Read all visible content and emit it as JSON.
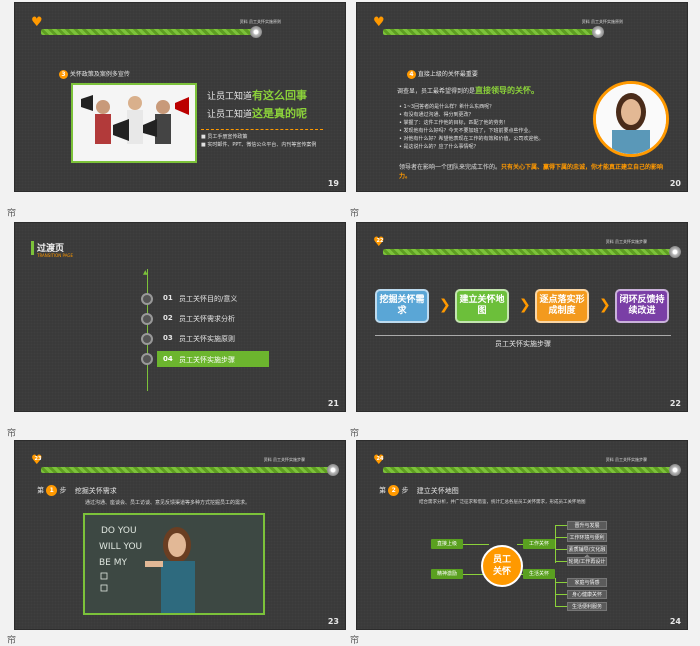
{
  "slides": {
    "s19": {
      "page": "19",
      "header_caption": "资料 员工关怀实施原则",
      "heading_num": "3",
      "heading": "关怀政策及案例多宣传",
      "line1_prefix": "让员工知道",
      "line1_emph": "有这么回事",
      "line2_prefix": "让员工知道",
      "line2_emph": "这是真的呢",
      "bullets": [
        "员工手册宣传政策",
        "实时邮件、PPT、微信公众平台、内刊等宣传案例"
      ]
    },
    "s20": {
      "page": "20",
      "header_caption": "资料 员工关怀实施原则",
      "heading_num": "4",
      "heading": "直接上级的关怀最重要",
      "intro_prefix": "调查显，员工最希望得到的是",
      "intro_emph": "直接领导的关怀。",
      "bullets": [
        "1~3回答者的是什么样？希什么东西呢？",
        "有没有通过沟通、得分到更改？",
        "掌握了：这件工作他的目标，匹配了他的劳务！",
        "发现他有什么好吗？今天不要加班了，下班前要点些作业。",
        "对他有什么好？希望他表现在工作的有效和价值，公司欢迎他。",
        "是这说什么的？应了什么事情呢？"
      ],
      "footer_prefix": "领导者在影响一个团队来完成工作的。",
      "footer_emph": "只有关心下属、赢得下属的忠诚，你才能真正建立自己的影响力。"
    },
    "s21": {
      "page": "21",
      "title": "过渡页",
      "subtitle": "TRANSITION PAGE",
      "items": [
        {
          "num": "01",
          "label": "员工关怀目的/意义"
        },
        {
          "num": "02",
          "label": "员工关怀需求分析"
        },
        {
          "num": "03",
          "label": "员工关怀实施原则"
        },
        {
          "num": "04",
          "label": "员工关怀实施步骤"
        }
      ]
    },
    "s22": {
      "page": "22",
      "heart_num": "22",
      "header_caption": "资料 员工关怀实施步骤",
      "steps": [
        {
          "label": "挖掘关怀需求",
          "color": "#5aa6d6"
        },
        {
          "label": "建立关怀地图",
          "color": "#6cbf3a"
        },
        {
          "label": "逐点落实形成制度",
          "color": "#f39a1e"
        },
        {
          "label": "闭环反馈持续改进",
          "color": "#7a3fa6"
        }
      ],
      "caption": "员工关怀实施步骤"
    },
    "s23": {
      "page": "23",
      "heart_num": "23",
      "header_caption": "资料 员工关怀实施步骤",
      "step_prefix": "第",
      "step_num": "1",
      "step_suffix": "步",
      "step_title": "挖掘关怀需求",
      "desc": "通过沟通、座谈会、员工访谈、意见反馈渠道等多种方式挖掘员工的需求。",
      "chalk_lines": [
        "DO YOU",
        "WILL YOU",
        "BE MY"
      ]
    },
    "s24": {
      "page": "24",
      "heart_num": "24",
      "header_caption": "资料 员工关怀实施步骤",
      "step_prefix": "第",
      "step_num": "2",
      "step_suffix": "步",
      "step_title": "建立关怀地图",
      "desc": "结合需求分析，并广泛征求和借鉴，统计汇总各层员工关怀需求，形成员工关怀地图",
      "center": "员工关怀",
      "left_nodes": [
        "直接上级",
        "精神激励"
      ],
      "right_nodes": [
        "工作关怀",
        "生活关怀"
      ],
      "work_leaves": [
        "晋升与发展",
        "工作环境与便利",
        "素质辅导/文化融合",
        "轮岗/工作再设计"
      ],
      "life_leaves": [
        "家庭与情感",
        "身心健康关怀",
        "生活便利服务"
      ]
    }
  },
  "corner_symbol": "帘"
}
